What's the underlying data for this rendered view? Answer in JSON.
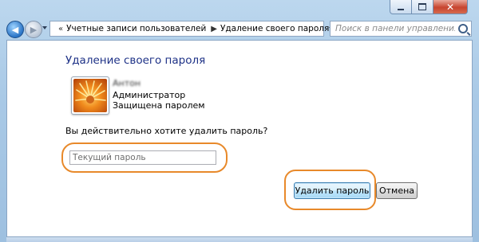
{
  "window": {
    "caption_buttons": [
      "minimize-icon",
      "maximize-icon",
      "close-icon"
    ],
    "close_glyph": "✕"
  },
  "nav": {
    "back_icon": "back-arrow-icon",
    "forward_icon": "forward-arrow-icon",
    "back_glyph": "◀",
    "forward_glyph": "▶",
    "breadcrumb_separator_start": "«",
    "breadcrumb_1": "Учетные записи пользователей",
    "breadcrumb_separator": "▶",
    "breadcrumb_2": "Удаление своего пароля",
    "refresh_glyph": "↻",
    "search_placeholder": "Поиск в панели управления"
  },
  "main": {
    "title": "Удаление своего пароля",
    "user": {
      "name": "Антон",
      "role": "Администратор",
      "status": "Защищена паролем"
    },
    "question": "Вы действительно хотите удалить пароль?",
    "password_placeholder": "Текущий пароль",
    "password_value": "",
    "confirm_button": "Удалить пароль",
    "cancel_button": "Отмена"
  },
  "colors": {
    "title_blue": "#1e3287",
    "highlight_orange": "#e8892a"
  }
}
